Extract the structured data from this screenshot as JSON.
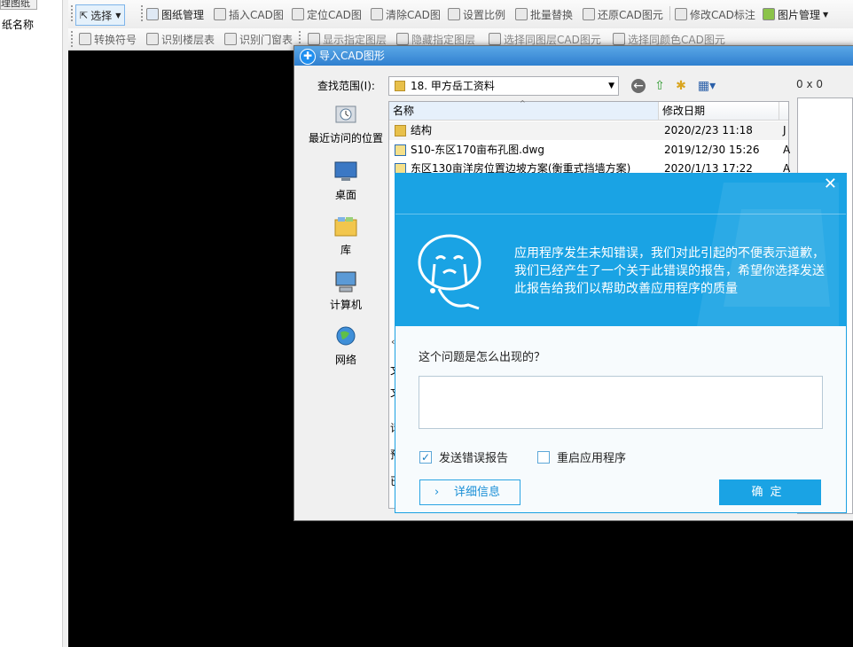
{
  "left_panel": {
    "tab": "理图纸",
    "column": "纸名称"
  },
  "toolbar1": [
    {
      "label": "选择",
      "icon": "cursor-icon"
    },
    {
      "label": "图纸管理",
      "icon": "drawing-manage-icon"
    },
    {
      "label": "插入CAD图",
      "icon": "insert-cad-icon"
    },
    {
      "label": "定位CAD图",
      "icon": "locate-cad-icon"
    },
    {
      "label": "清除CAD图",
      "icon": "clear-cad-icon"
    },
    {
      "label": "设置比例",
      "icon": "scale-icon"
    },
    {
      "label": "批量替换",
      "icon": "batch-replace-icon"
    },
    {
      "label": "还原CAD图元",
      "icon": "restore-cad-icon"
    },
    {
      "label": "修改CAD标注",
      "icon": "edit-annotation-icon"
    },
    {
      "label": "图片管理",
      "icon": "image-manage-icon"
    }
  ],
  "toolbar2": [
    {
      "label": "转换符号",
      "icon": "convert-symbol-icon"
    },
    {
      "label": "识别楼层表",
      "icon": "floor-table-icon"
    },
    {
      "label": "识别门窗表",
      "icon": "door-window-icon"
    },
    {
      "label": "显示指定图层",
      "icon": "show-layer-icon"
    },
    {
      "label": "隐藏指定图层",
      "icon": "hide-layer-icon"
    },
    {
      "label": "选择同图层CAD图元",
      "icon": "select-layer-icon"
    },
    {
      "label": "选择同颜色CAD图元",
      "icon": "select-color-icon"
    }
  ],
  "dialog": {
    "title": "导入CAD图形",
    "lookin_label": "查找范围(I):",
    "lookin_value": "18. 甲方岳工资料",
    "preview_size": "0 x 0",
    "places": [
      "最近访问的位置",
      "桌面",
      "库",
      "计算机",
      "网络"
    ],
    "columns": {
      "name": "名称",
      "date": "修改日期"
    },
    "files": [
      {
        "name": "结构",
        "date": "2020/2/23 11:18",
        "extra": "J"
      },
      {
        "name": "S10-东区170亩布孔图.dwg",
        "date": "2019/12/30 15:26",
        "extra": "A"
      },
      {
        "name": "东区130亩洋房位置边坡方案(衡重式挡墙方案)",
        "date": "2020/1/13 17:22",
        "extra": "A"
      }
    ],
    "left_labels": [
      "文",
      "文",
      "请",
      "预",
      "已"
    ]
  },
  "error_popup": {
    "message": "应用程序发生未知错误，我们对此引起的不便表示道歉，我们已经产生了一个关于此错误的报告，希望你选择发送此报告给我们以帮助改善应用程序的质量",
    "question": "这个问题是怎么出现的？",
    "input_value": "",
    "send_report_label": "发送错误报告",
    "send_report_checked": true,
    "restart_label": "重启应用程序",
    "restart_checked": false,
    "detail_button": "详细信息",
    "ok_button": "确定",
    "close_glyph": "✕"
  },
  "colors": {
    "accent": "#1aa3e4",
    "canvas": "#000000",
    "dialog_title": "#2f7fcf"
  }
}
